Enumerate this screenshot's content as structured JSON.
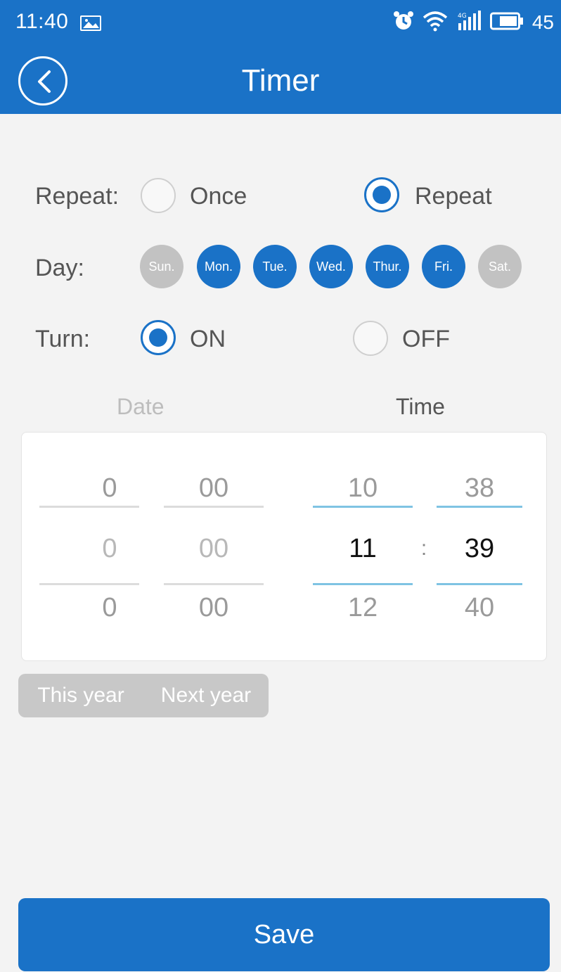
{
  "status_bar": {
    "time": "11:40",
    "battery": "45"
  },
  "app_bar": {
    "title": "Timer"
  },
  "repeat": {
    "label": "Repeat:",
    "options": [
      "Once",
      "Repeat"
    ],
    "selected": "Repeat"
  },
  "day": {
    "label": "Day:",
    "days": [
      {
        "label": "Sun.",
        "active": false
      },
      {
        "label": "Mon.",
        "active": true
      },
      {
        "label": "Tue.",
        "active": true
      },
      {
        "label": "Wed.",
        "active": true
      },
      {
        "label": "Thur.",
        "active": true
      },
      {
        "label": "Fri.",
        "active": true
      },
      {
        "label": "Sat.",
        "active": false
      }
    ]
  },
  "turn": {
    "label": "Turn:",
    "options": [
      "ON",
      "OFF"
    ],
    "selected": "ON"
  },
  "picker": {
    "date_header": "Date",
    "time_header": "Time",
    "date_col1": [
      "0",
      "0",
      "0"
    ],
    "date_col2": [
      "00",
      "00",
      "00"
    ],
    "hour": [
      "10",
      "11",
      "12"
    ],
    "separator": ":",
    "minute": [
      "38",
      "39",
      "40"
    ]
  },
  "year_toggle": {
    "options": [
      "This year",
      "Next year"
    ]
  },
  "save_label": "Save",
  "colors": {
    "primary": "#1a72c7",
    "inactive_day": "#c2c2c2",
    "accent_line": "#7fc3e3"
  }
}
